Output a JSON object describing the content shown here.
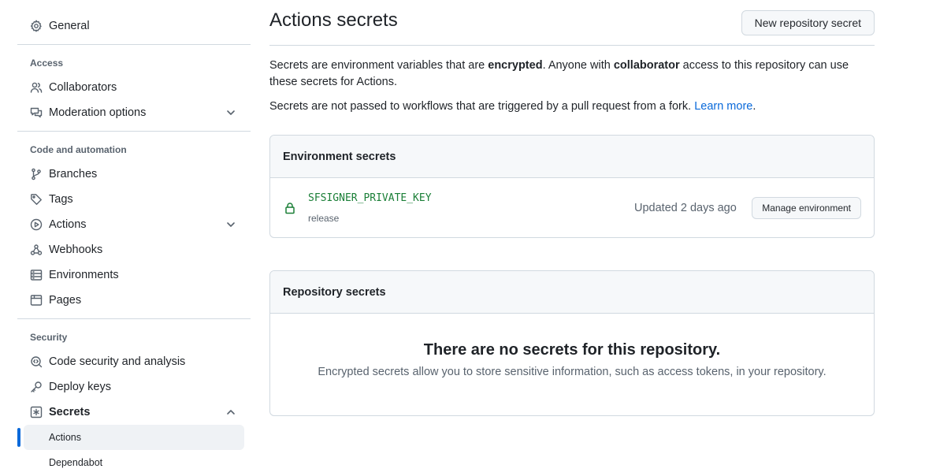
{
  "sidebar": {
    "general": "General",
    "access_heading": "Access",
    "collaborators": "Collaborators",
    "moderation": "Moderation options",
    "code_heading": "Code and automation",
    "branches": "Branches",
    "tags": "Tags",
    "actions": "Actions",
    "webhooks": "Webhooks",
    "environments": "Environments",
    "pages": "Pages",
    "security_heading": "Security",
    "code_security": "Code security and analysis",
    "deploy_keys": "Deploy keys",
    "secrets": "Secrets",
    "secrets_sub": [
      "Actions",
      "Dependabot"
    ]
  },
  "header": {
    "title": "Actions secrets",
    "new_secret_button": "New repository secret"
  },
  "intro": {
    "p1_a": "Secrets are environment variables that are ",
    "p1_b": "encrypted",
    "p1_c": ". Anyone with ",
    "p1_d": "collaborator",
    "p1_e": " access to this repository can use these secrets for Actions.",
    "p2": "Secrets are not passed to workflows that are triggered by a pull request from a fork. ",
    "learn_more": "Learn more",
    "p2_end": "."
  },
  "environment_secrets": {
    "heading": "Environment secrets",
    "items": [
      {
        "name": "SFSIGNER_PRIVATE_KEY",
        "environment": "release",
        "updated": "Updated 2 days ago",
        "action": "Manage environment"
      }
    ]
  },
  "repository_secrets": {
    "heading": "Repository secrets",
    "empty_title": "There are no secrets for this repository.",
    "empty_desc": "Encrypted secrets allow you to store sensitive information, such as access tokens, in your repository."
  },
  "colors": {
    "accent": "#0969da",
    "success": "#1a7f37",
    "muted": "#59636e",
    "border": "#d1d9e0"
  }
}
